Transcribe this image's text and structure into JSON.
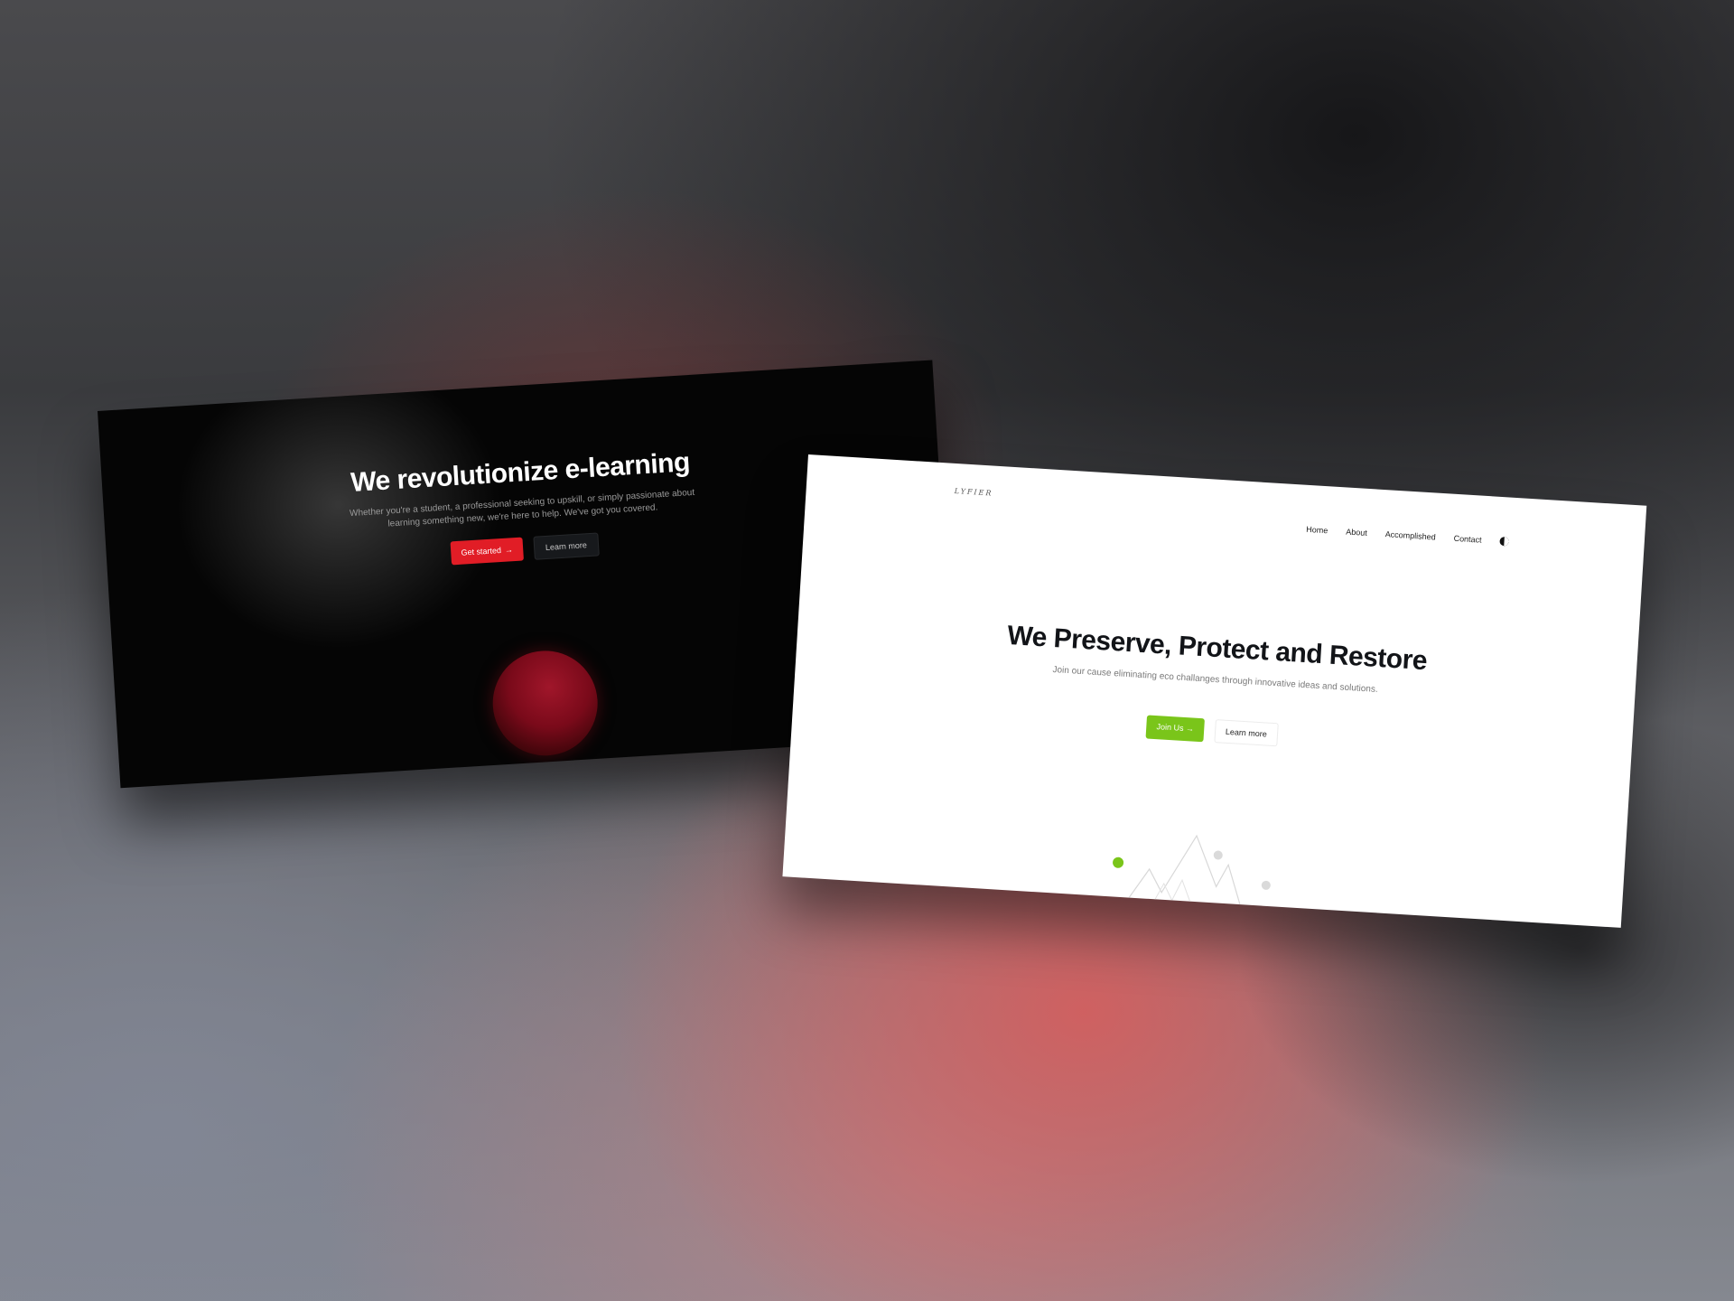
{
  "dark_page": {
    "title": "We revolutionize e-learning",
    "subtitle": "Whether you're a student, a professional seeking to upskill, or simply passionate about learning something new, we're here to help. We've got you covered.",
    "primary_button": "Get started",
    "primary_button_arrow": "→",
    "secondary_button": "Learn more",
    "accent_color": "#e11d26"
  },
  "light_page": {
    "logo": "LYFIER",
    "nav": [
      "Home",
      "About",
      "Accomplished",
      "Contact"
    ],
    "title": "We Preserve, Protect and Restore",
    "subtitle": "Join our cause eliminating eco challanges through innovative ideas and solutions.",
    "primary_button": "Join Us",
    "primary_button_arrow": "→",
    "secondary_button": "Learn more",
    "accent_color": "#7ac51a"
  }
}
